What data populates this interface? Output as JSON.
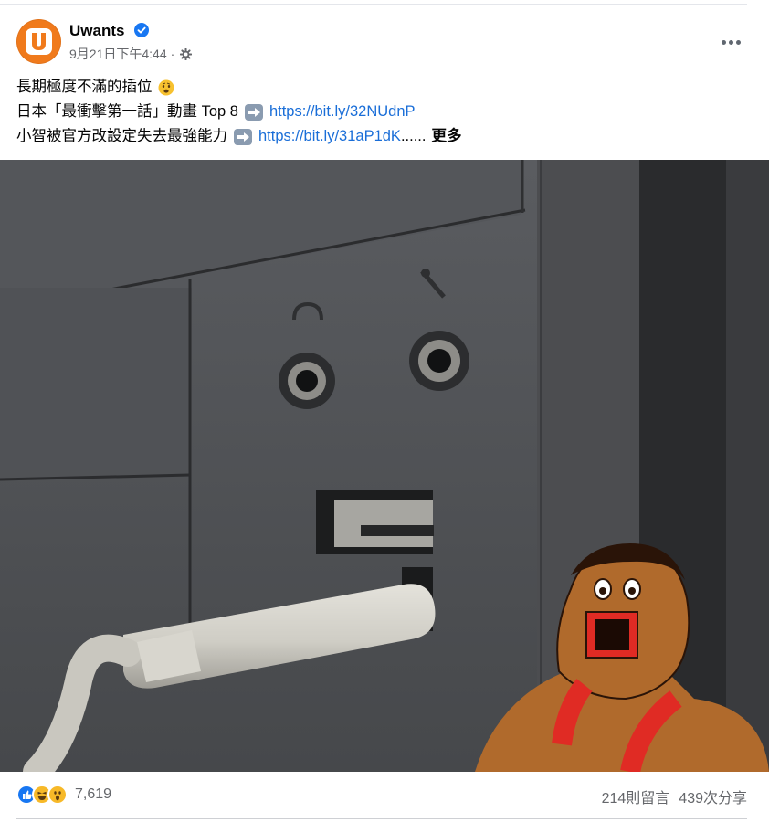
{
  "post": {
    "page_name": "Uwants",
    "timestamp": "9月21日下午4:44",
    "dot": "·",
    "avatar_letter": "U",
    "text": {
      "line1": "長期極度不滿的插位",
      "line2_prefix": "日本「最衝擊第一話」動畫 Top 8",
      "line2_link": "https://bit.ly/32NUdnP",
      "line3_prefix": "小智被官方改設定失去最強能力",
      "line3_link": "https://bit.ly/31aP1dK",
      "line3_ellipsis": "......",
      "see_more": "更多"
    }
  },
  "footer": {
    "reaction_count": "7,619",
    "comments": "214則留言",
    "shares": "439次分享"
  },
  "icons": {
    "verified": "verified-badge-icon",
    "audience": "globe-icon",
    "more": "more-options-icon",
    "reactions": [
      "like-icon",
      "haha-icon",
      "wow-icon"
    ]
  },
  "colors": {
    "brand_orange": "#f07a1c",
    "link": "#1a6ed8",
    "like_blue": "#1877f2",
    "secondary_text": "#65676b"
  }
}
